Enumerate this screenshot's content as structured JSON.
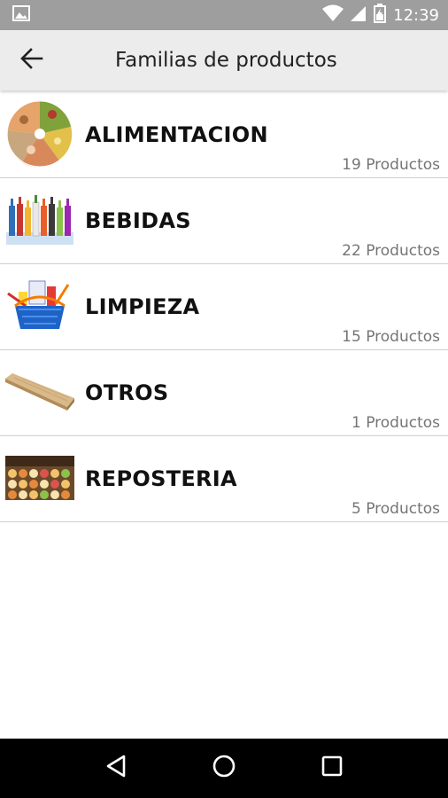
{
  "status_bar": {
    "time": "12:39",
    "icons": [
      "image-icon",
      "wifi-icon",
      "signal-icon",
      "battery-icon"
    ]
  },
  "app_bar": {
    "title": "Familias de productos",
    "back_icon": "arrow-left-icon"
  },
  "families": [
    {
      "name": "ALIMENTACION",
      "count": "19 Productos",
      "thumb": "food-plate-image"
    },
    {
      "name": "BEBIDAS",
      "count": "22 Productos",
      "thumb": "drink-bottles-image"
    },
    {
      "name": "LIMPIEZA",
      "count": "15 Productos",
      "thumb": "cleaning-basket-image"
    },
    {
      "name": "OTROS",
      "count": "1 Productos",
      "thumb": "wood-plank-image"
    },
    {
      "name": "REPOSTERIA",
      "count": "5 Productos",
      "thumb": "pastries-tray-image"
    }
  ],
  "nav_bar": {
    "icons": [
      "back-triangle-icon",
      "home-circle-icon",
      "recents-square-icon"
    ]
  },
  "colors": {
    "status_bar": "#9e9e9e",
    "app_bar": "#ececec",
    "divider": "#cfcfcf",
    "count_text": "#757575",
    "nav_bar": "#000000"
  }
}
